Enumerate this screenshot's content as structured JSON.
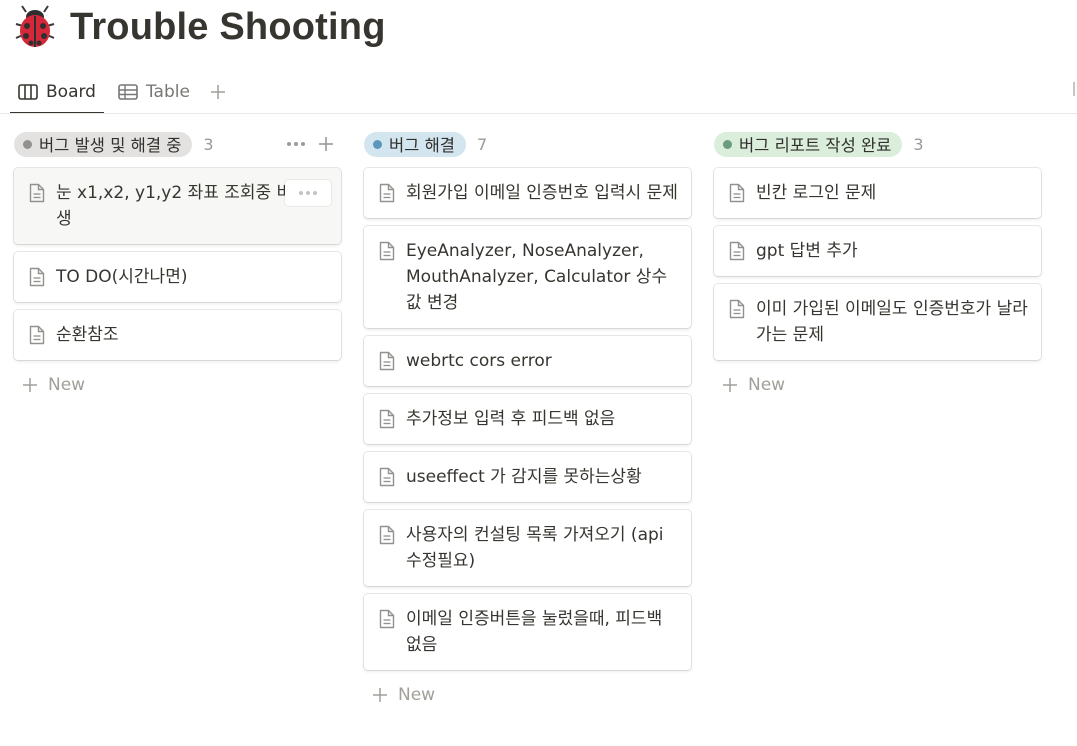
{
  "page": {
    "title": "Trouble Shooting",
    "icon": "ladybug-icon"
  },
  "tabs": [
    {
      "label": "Board",
      "icon": "board-icon",
      "active": true
    },
    {
      "label": "Table",
      "icon": "table-icon",
      "active": false
    }
  ],
  "board": {
    "new_label": "New",
    "columns": [
      {
        "name": "버그 발생 및 해결 중",
        "count": "3",
        "pill_color": "#e3e2e0",
        "dot_color": "#91918e",
        "cards": [
          "눈 x1,x2, y1,y2 좌표 조회중 버그 발생",
          "TO DO(시간나면)",
          "순환참조"
        ]
      },
      {
        "name": "버그 해결",
        "count": "7",
        "pill_color": "#d3e5ef",
        "dot_color": "#5b97bd",
        "cards": [
          "회원가입 이메일 인증번호 입력시 문제",
          "EyeAnalyzer, NoseAnalyzer, MouthAnalyzer, Calculator 상수값 변경",
          "webrtc cors error",
          "추가정보 입력 후 피드백 없음",
          "useeffect 가 감지를 못하는상황",
          "사용자의 컨설팅 목록 가져오기 (api수정필요)",
          "이메일 인증버튼을 눌렀을때, 피드백 없음"
        ]
      },
      {
        "name": "버그 리포트 작성 완료",
        "count": "3",
        "pill_color": "#dbeddb",
        "dot_color": "#6c9b7d",
        "cards": [
          "빈칸 로그인 문제",
          "gpt 답변 추가",
          "이미 가입된 이메일도 인증번호가 날라가는 문제"
        ]
      }
    ]
  }
}
